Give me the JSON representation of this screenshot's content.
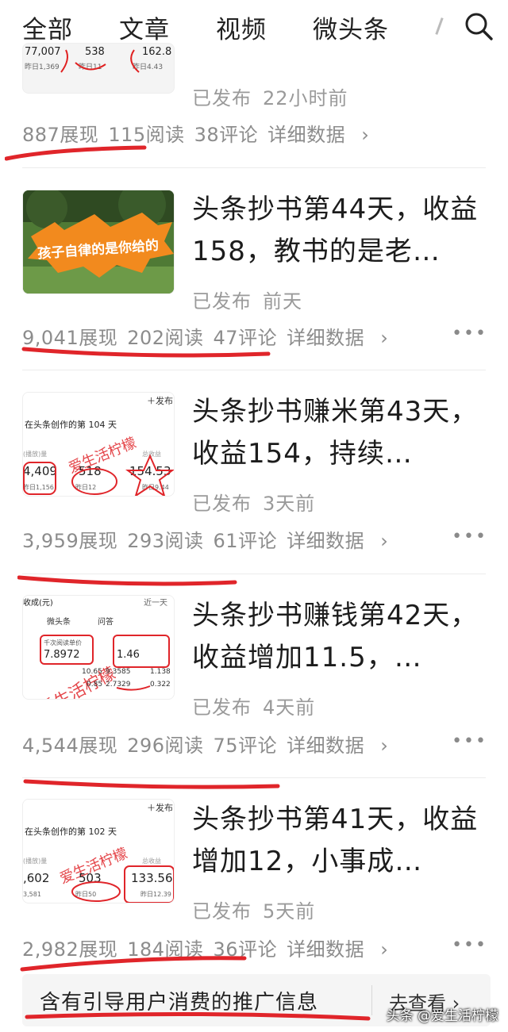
{
  "tabs": [
    {
      "label": "全部"
    },
    {
      "label": "文章"
    },
    {
      "label": "视频"
    },
    {
      "label": "微头条"
    }
  ],
  "icons": {
    "search": "search-icon",
    "chevron": "chevron-right-icon",
    "more": "more-dots-icon"
  },
  "accent_color": "#e02020",
  "articles": [
    {
      "title": "",
      "status": "已发布",
      "time": "22小时前",
      "impressions": "887展现",
      "reads": "115阅读",
      "comments": "38评论",
      "detail": "详细数据",
      "thumb_text": [
        "77,007",
        "538",
        "162.8",
        "昨日1,369",
        "昨日11",
        "昨日4.43"
      ]
    },
    {
      "title": "头条抄书第44天，收益158，教书的是老…",
      "status": "已发布",
      "time": "前天",
      "impressions": "9,041展现",
      "reads": "202阅读",
      "comments": "47评论",
      "detail": "详细数据",
      "thumb_text": [
        "孩子自律的是你给的"
      ]
    },
    {
      "title": "头条抄书赚米第43天，收益154，持续…",
      "status": "已发布",
      "time": "3天前",
      "impressions": "3,959展现",
      "reads": "293阅读",
      "comments": "61评论",
      "detail": "详细数据",
      "thumb_text": [
        "＋发布",
        "在头条创作的第 104 天",
        "爱生活柠檬",
        "4,409",
        "518",
        "154.53",
        "昨日1,156",
        "昨日12",
        "昨日9.44",
        "(播放)量",
        "总收益"
      ]
    },
    {
      "title": "头条抄书赚钱第42天，收益增加11.5，…",
      "status": "已发布",
      "time": "4天前",
      "impressions": "4,544展现",
      "reads": "296阅读",
      "comments": "75评论",
      "detail": "详细数据",
      "thumb_text": [
        "收成(元)",
        "近一天",
        "微头条",
        "问答",
        "千次阅读单价",
        "7.8972",
        "1.46",
        "爱生活柠檬",
        "10.65",
        "9.3585",
        "1.138",
        "0.85",
        "2.7329",
        "0.322"
      ]
    },
    {
      "title": "头条抄书第41天，收益增加12，小事成…",
      "status": "已发布",
      "time": "5天前",
      "impressions": "2,982展现",
      "reads": "184阅读",
      "comments": "36评论",
      "detail": "详细数据",
      "thumb_text": [
        "＋发布",
        "在头条创作的第 102 天",
        "爱生活柠檬",
        ",602",
        "503",
        "133.56",
        "3,581",
        "昨日50",
        "昨日12.39",
        "(播放)量",
        "总收益"
      ]
    }
  ],
  "promo": {
    "text": "含有引导用户消费的推广信息",
    "link": "去查看"
  },
  "watermark": "头条 @爱生活柠檬"
}
